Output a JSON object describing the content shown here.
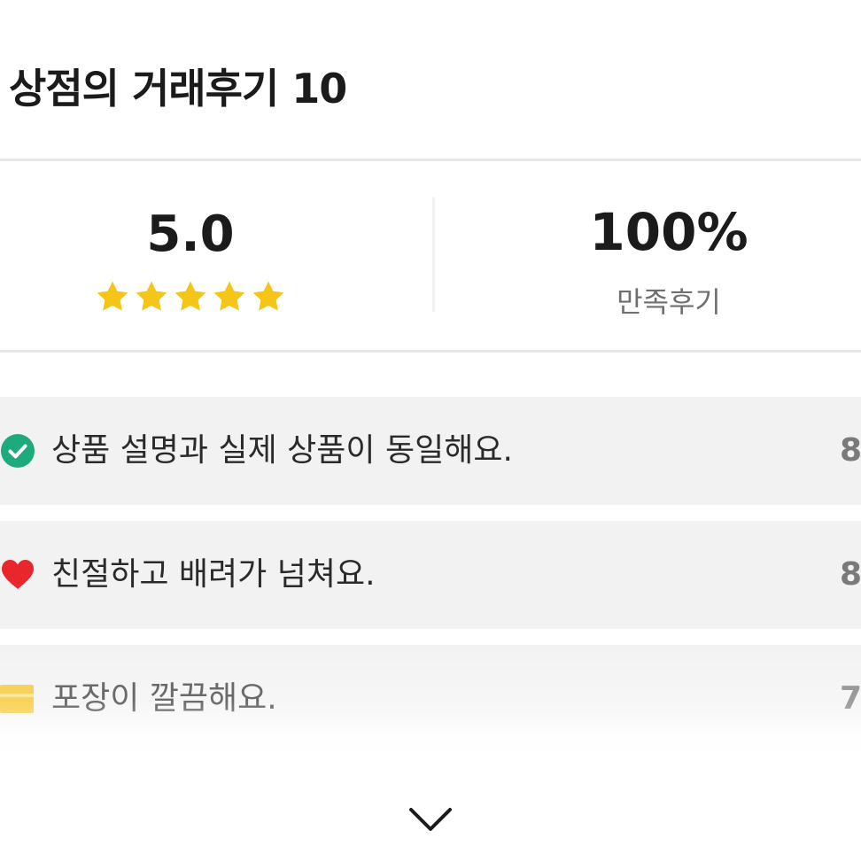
{
  "header": {
    "title": "상점의 거래후기 10"
  },
  "summary": {
    "rating": "5.0",
    "stars_filled": 5,
    "stars_total": 5,
    "star_color": "#F5C518",
    "satisfaction_value": "100%",
    "satisfaction_label": "만족후기"
  },
  "reviews": [
    {
      "icon": "check-circle-icon",
      "icon_color": "#1DAA7D",
      "text": "상품 설명과 실제 상품이 동일해요.",
      "count": "8"
    },
    {
      "icon": "heart-icon",
      "icon_color": "#E8262B",
      "text": "친절하고 배려가 넘쳐요.",
      "count": "8"
    },
    {
      "icon": "package-icon",
      "icon_color": "#F8D25A",
      "text": "포장이 깔끔해요.",
      "count": "7"
    }
  ],
  "more": {
    "icon": "chevron-down-icon"
  }
}
